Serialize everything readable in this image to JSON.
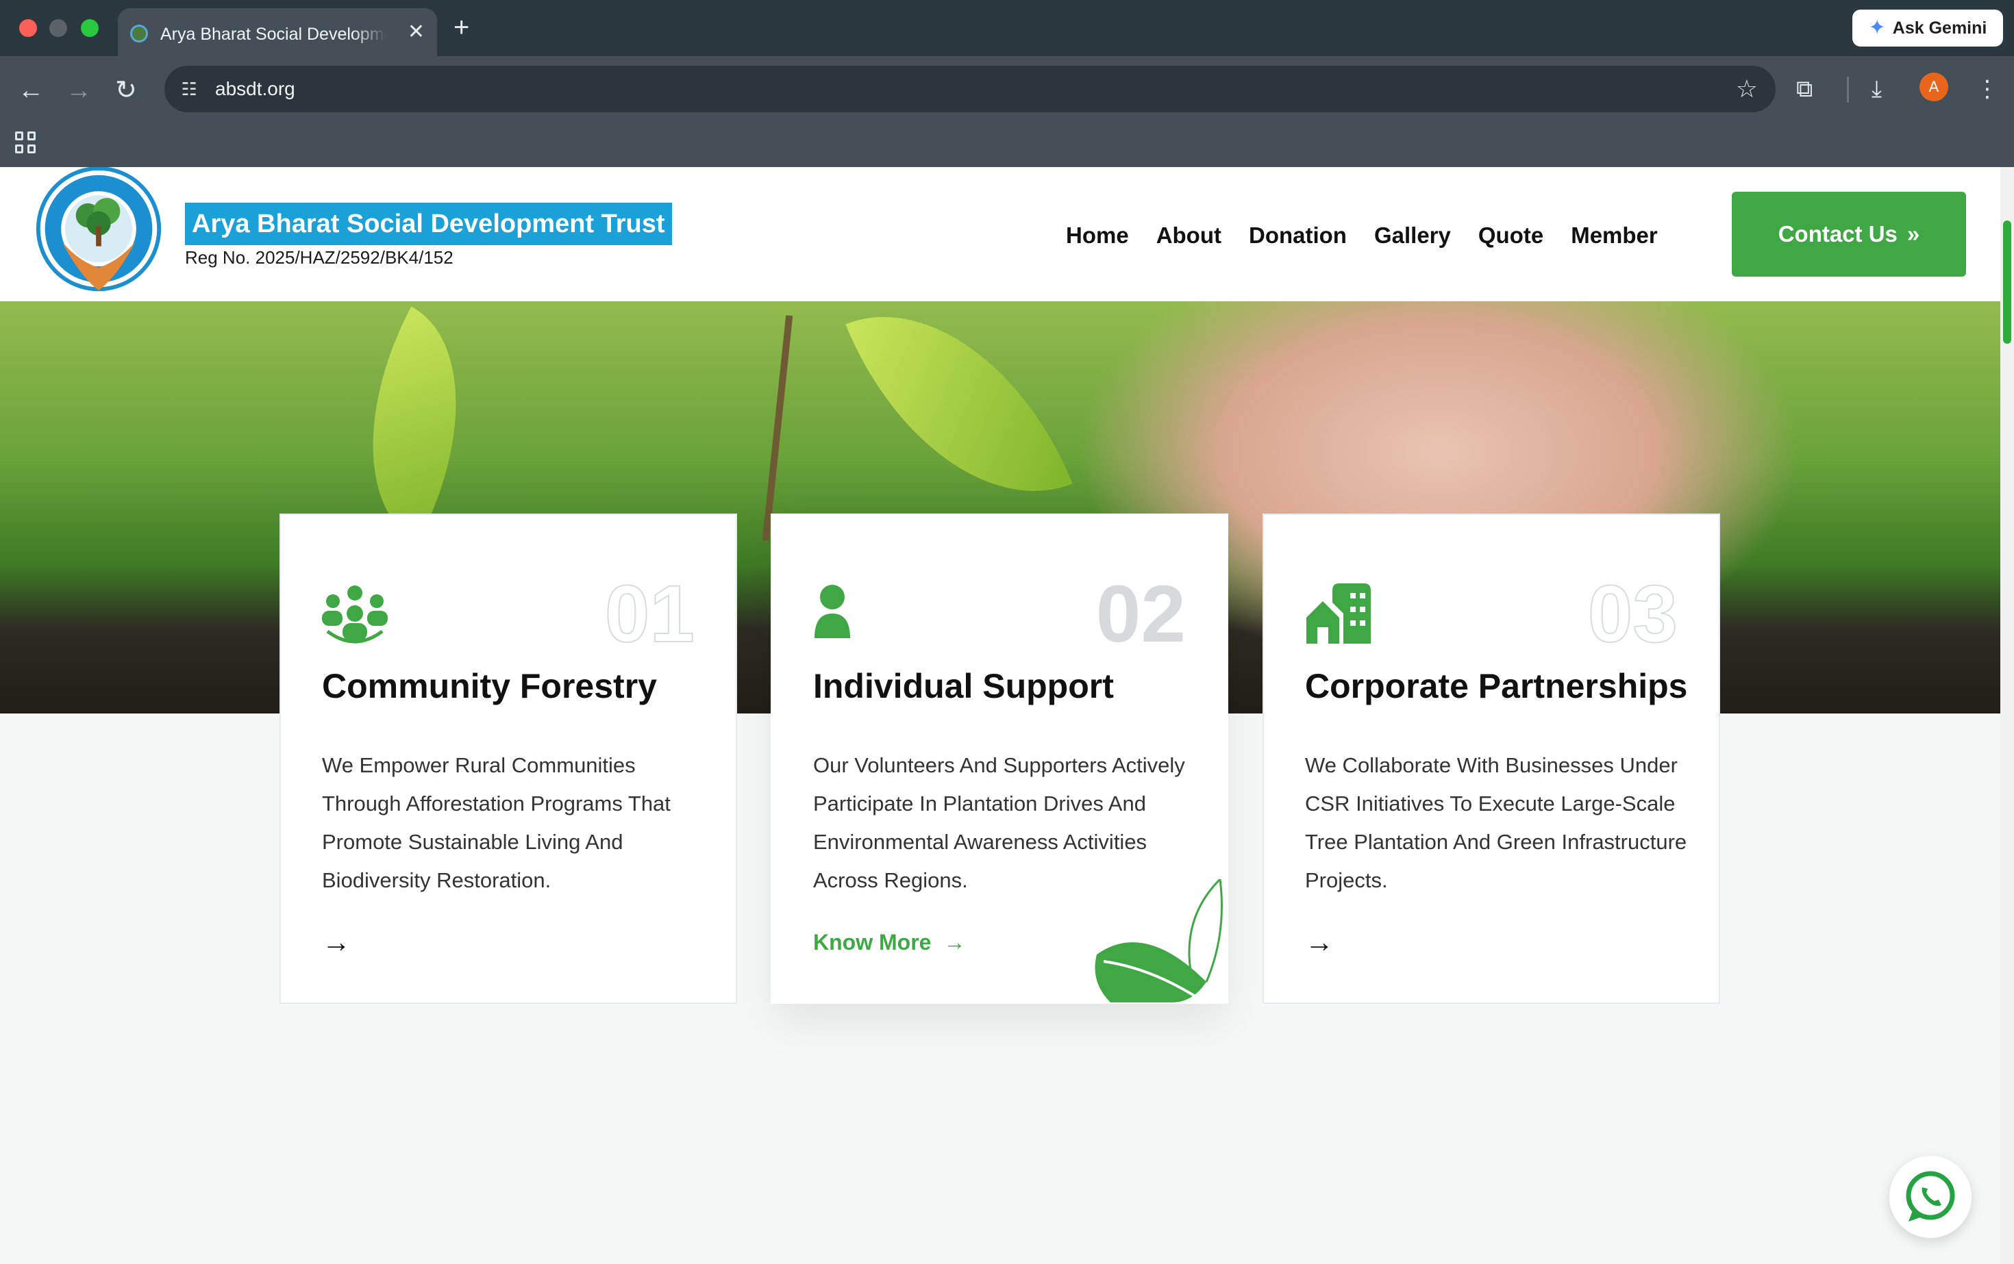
{
  "browser": {
    "tab_title": "Arya Bharat Social Development Trust",
    "tab_close": "✕",
    "new_tab": "+",
    "gemini_label": "Ask Gemini",
    "url": "absdt.org",
    "profile_initial": "A"
  },
  "header": {
    "brand_name": "Arya Bharat Social Development Trust",
    "reg_no": "Reg No. 2025/HAZ/2592/BK4/152",
    "nav": [
      "Home",
      "About",
      "Donation",
      "Gallery",
      "Quote",
      "Member"
    ],
    "contact_label": "Contact Us",
    "contact_icon": "»"
  },
  "cards": [
    {
      "number": "01",
      "title": "Community Forestry",
      "text": "We Empower Rural Communities Through Afforestation Programs That Promote Sustainable Living And Biodiversity Restoration.",
      "icon": "people-group-icon"
    },
    {
      "number": "02",
      "title": "Individual Support",
      "text": "Our Volunteers And Supporters Actively Participate In Plantation Drives And Environmental Awareness Activities Across Regions.",
      "link": "Know More",
      "icon": "user-icon"
    },
    {
      "number": "03",
      "title": "Corporate Partnerships",
      "text": "We Collaborate With Businesses Under CSR Initiatives To Execute Large-Scale Tree Plantation And Green Infrastructure Projects.",
      "icon": "buildings-icon"
    }
  ],
  "colors": {
    "accent_green": "#3fa844",
    "brand_blue": "#1ba0d8"
  }
}
